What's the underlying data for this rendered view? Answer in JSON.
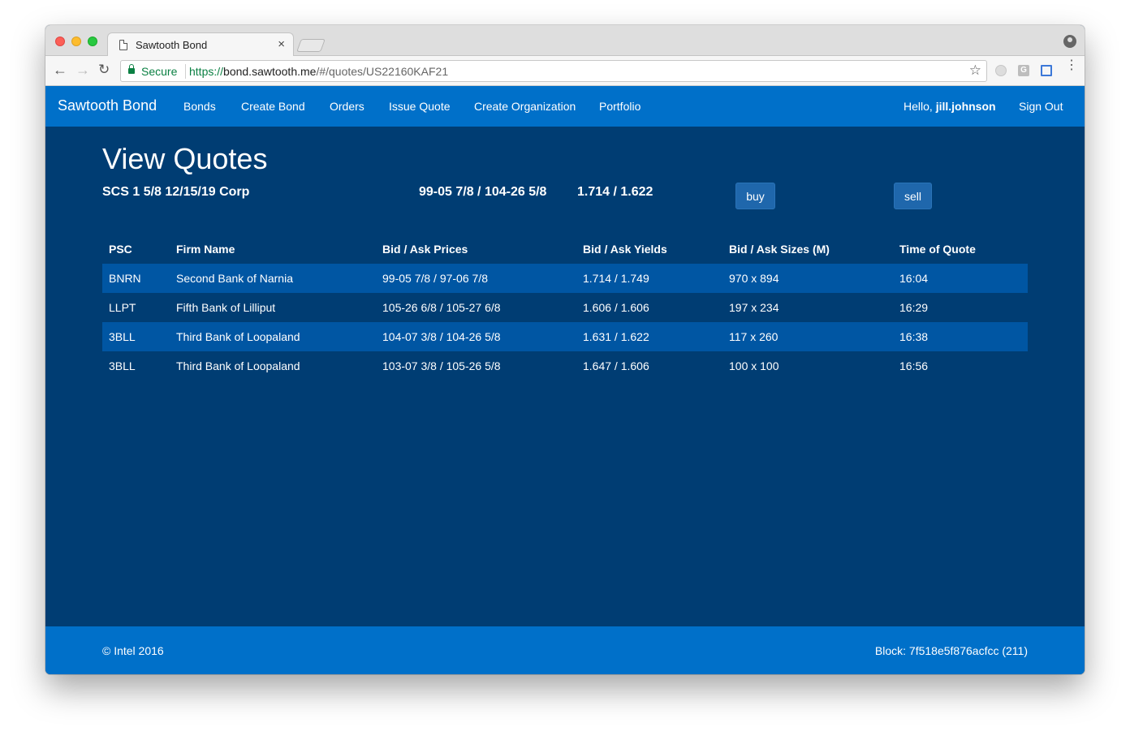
{
  "browser": {
    "tab_title": "Sawtooth Bond",
    "close_glyph": "×",
    "secure_label": "Secure",
    "url_scheme": "https://",
    "url_host": "bond.sawtooth.me",
    "url_path": "/#/quotes/US22160KAF21",
    "back_glyph": "←",
    "forward_glyph": "→",
    "reload_glyph": "↻",
    "star_glyph": "☆",
    "menu_glyph": "⋮",
    "ext2_letter": "G"
  },
  "navbar": {
    "brand": "Sawtooth Bond",
    "links": [
      "Bonds",
      "Create Bond",
      "Orders",
      "Issue Quote",
      "Create Organization",
      "Portfolio"
    ],
    "greeting_prefix": "Hello, ",
    "username": "jill.johnson",
    "sign_out": "Sign Out"
  },
  "page": {
    "title": "View Quotes",
    "bond_name": "SCS 1 5/8 12/15/19 Corp",
    "bond_prices": "99-05 7/8 / 104-26 5/8",
    "bond_yields": "1.714 / 1.622",
    "buy_label": "buy",
    "sell_label": "sell"
  },
  "table": {
    "headers": [
      "PSC",
      "Firm Name",
      "Bid / Ask Prices",
      "Bid / Ask Yields",
      "Bid / Ask Sizes (M)",
      "Time of Quote"
    ],
    "rows": [
      [
        "BNRN",
        "Second Bank of Narnia",
        "99-05 7/8 / 97-06 7/8",
        "1.714 / 1.749",
        "970 x 894",
        "16:04"
      ],
      [
        "LLPT",
        "Fifth Bank of Lilliput",
        "105-26 6/8 / 105-27 6/8",
        "1.606 / 1.606",
        "197 x 234",
        "16:29"
      ],
      [
        "3BLL",
        "Third Bank of Loopaland",
        "104-07 3/8 / 104-26 5/8",
        "1.631 / 1.622",
        "117 x 260",
        "16:38"
      ],
      [
        "3BLL",
        "Third Bank of Loopaland",
        "103-07 3/8 / 105-26 5/8",
        "1.647 / 1.606",
        "100 x 100",
        "16:56"
      ]
    ]
  },
  "footer": {
    "copyright": "© Intel 2016",
    "block": "Block: 7f518e5f876acfcc (211)"
  },
  "colors": {
    "navbar": "#0070c9",
    "content_bg": "#003d73",
    "row_stripe": "#0056a3",
    "button": "#1f67ac"
  }
}
